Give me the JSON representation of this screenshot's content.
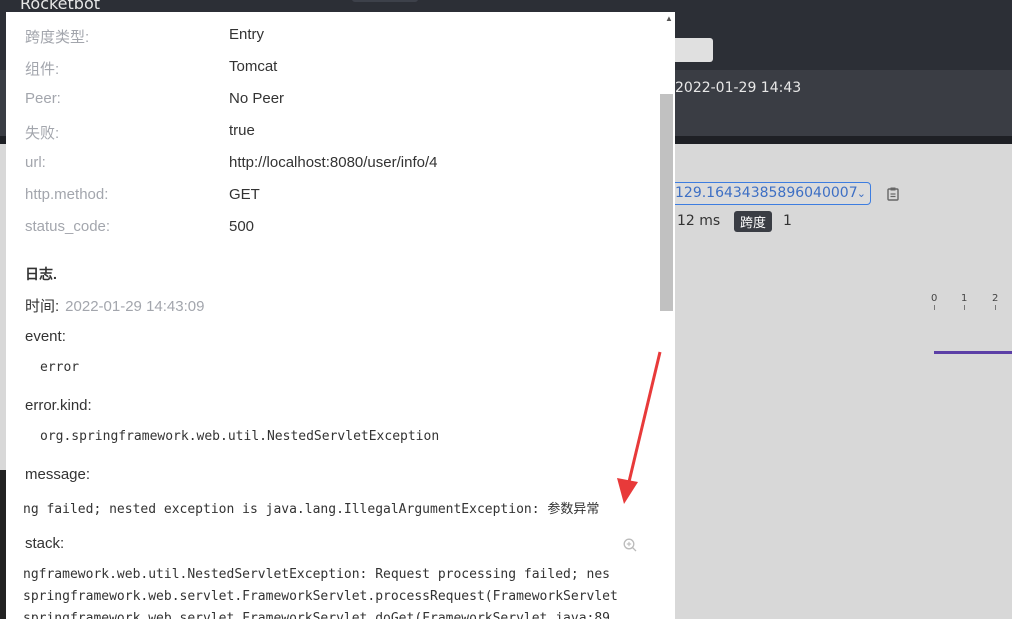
{
  "app": {
    "title": "Rocketbot"
  },
  "background": {
    "start_time": "2022-01-29 14:43",
    "trace_id": "129.16434385896040007",
    "duration": "12 ms",
    "span_label": "跨度",
    "span_count": "1",
    "ticks": [
      "0",
      "1",
      "2"
    ]
  },
  "tags": [
    {
      "key": "跨度类型:",
      "value": "Entry"
    },
    {
      "key": "组件:",
      "value": "Tomcat"
    },
    {
      "key": "Peer:",
      "value": "No Peer"
    },
    {
      "key": "失败:",
      "value": "true"
    },
    {
      "key": "url:",
      "value": "http://localhost:8080/user/info/4"
    },
    {
      "key": "http.method:",
      "value": "GET"
    },
    {
      "key": "status_code:",
      "value": "500"
    }
  ],
  "logs": {
    "title": "日志.",
    "time_label": "时间:",
    "time_value": "2022-01-29 14:43:09",
    "event_key": "event:",
    "event_value": "error",
    "error_kind_key": "error.kind:",
    "error_kind_value": "org.springframework.web.util.NestedServletException",
    "message_key": "message:",
    "message_value": "ng failed; nested exception is java.lang.IllegalArgumentException: 参数异常",
    "stack_key": "stack:",
    "stack_lines": [
      "ngframework.web.util.NestedServletException: Request processing failed; nes",
      "springframework.web.servlet.FrameworkServlet.processRequest(FrameworkServlet",
      "springframework.web.servlet.FrameworkServlet.doGet(FrameworkServlet.java:89"
    ]
  },
  "colors": {
    "annotation_arrow": "#e83a3a",
    "span_bar": "#5b3fa6",
    "select_accent": "#3d7de0"
  }
}
